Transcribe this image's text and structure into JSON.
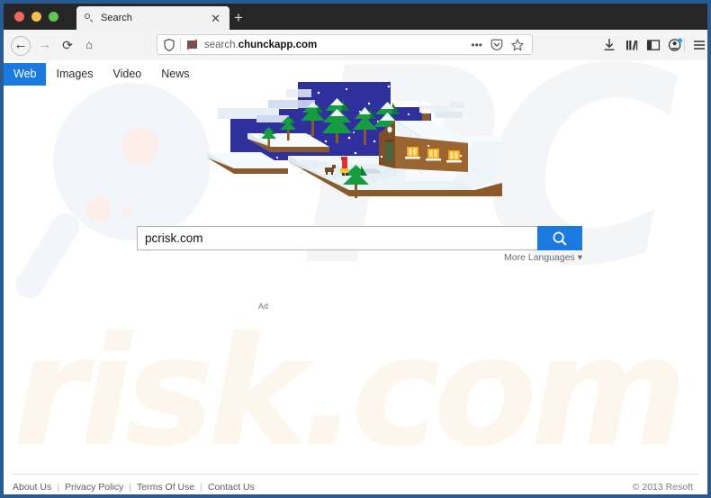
{
  "browser": {
    "tab": {
      "title": "Search",
      "favicon": "search-icon",
      "close": "✕"
    },
    "new_tab_label": "+",
    "nav": {
      "back": "←",
      "forward": "→",
      "reload": "⟳",
      "home": "⌂"
    },
    "address_bar": {
      "url_prefix": "search.",
      "url_domain": "chunckapp.com",
      "shield_icon": "shield-icon",
      "blocked_images_icon": "blocked-image-icon",
      "page_actions_icon": "•••",
      "pocket_icon": "pocket-icon",
      "bookmark_icon": "star-icon"
    },
    "toolbar_icons": [
      {
        "name": "downloads-icon",
        "glyph": "⤓"
      },
      {
        "name": "library-icon",
        "glyph": "library"
      },
      {
        "name": "sidebar-icon",
        "glyph": "sidebar"
      },
      {
        "name": "account-icon",
        "glyph": "account"
      },
      {
        "name": "menu-icon",
        "glyph": "☰"
      }
    ]
  },
  "site": {
    "nav_tabs": [
      {
        "label": "Web",
        "active": true
      },
      {
        "label": "Images",
        "active": false
      },
      {
        "label": "Video",
        "active": false
      },
      {
        "label": "News",
        "active": false
      }
    ],
    "search": {
      "value": "pcrisk.com",
      "placeholder": "",
      "button_icon": "search-icon"
    },
    "more_languages": "More Languages ▾",
    "ad_label": "Ad",
    "footer": {
      "links": [
        "About Us",
        "Privacy Policy",
        "Terms Of Use",
        "Contact Us"
      ],
      "separator": "|",
      "copyright": "© 2013 Resoft"
    },
    "watermark": {
      "top_text": "PC",
      "bottom_text": "risk.com",
      "glass_icon": "magnifier-watermark"
    },
    "illustration": {
      "name": "isometric-winter-village-scene",
      "elements": [
        "night-sky",
        "snow-platform",
        "pine-trees",
        "log-cabin",
        "person-with-dog",
        "clouds",
        "snowflakes"
      ]
    }
  },
  "colors": {
    "accent_blue": "#1a7ae0",
    "window_border": "#2b5a8e",
    "titlebar": "#262626",
    "night_sky": "#2f2f9e",
    "house_wall": "#8b5a2b",
    "tree_green": "#169c43",
    "watermark_cream": "#fdf6ec",
    "watermark_gray": "#f4f5f6"
  }
}
